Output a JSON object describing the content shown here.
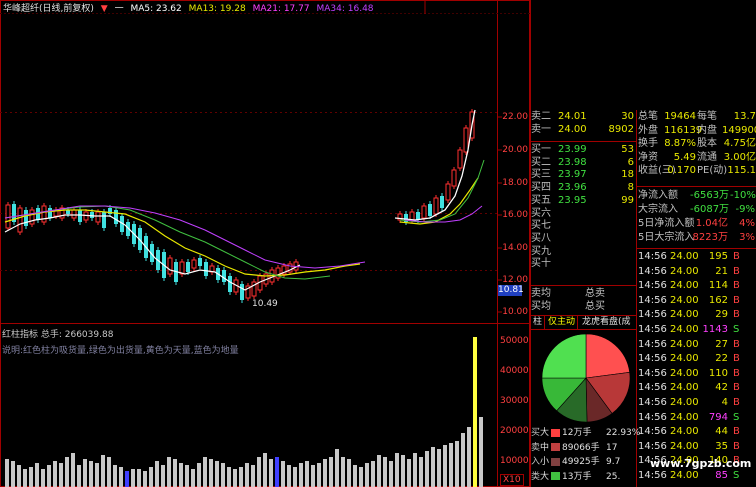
{
  "header": {
    "stock_name": "华峰超纤(日线,前复权)",
    "arrow": "一",
    "ma5": "MA5: 23.62",
    "ma13": "MA13: 19.28",
    "ma21": "MA21: 17.77",
    "ma34": "MA34: 16.48",
    "colors": {
      "ma5": "#ffffff",
      "ma13": "#e8e800",
      "ma21": "#ff40ff",
      "ma34": "#c040ff"
    }
  },
  "price_axis": [
    "22.00",
    "20.00",
    "18.00",
    "16.00",
    "14.00",
    "12.00",
    "10.00"
  ],
  "current_price_tag": "10.81",
  "low_marker": "10.49",
  "indicator": {
    "title": "红柱指标  总手: 266039.88",
    "description": "说明:红色柱为吸货量,绿色为出货量,黄色为天量,蓝色为地量",
    "volume_axis": [
      "50000",
      "40000",
      "30000",
      "20000",
      "10000"
    ],
    "unit": "X10"
  },
  "order_book": {
    "asks": [
      {
        "label": "卖二",
        "price": "24.01",
        "vol": "30"
      },
      {
        "label": "卖一",
        "price": "24.00",
        "vol": "8902"
      }
    ],
    "bids": [
      {
        "label": "买一",
        "price": "23.99",
        "vol": "53"
      },
      {
        "label": "买二",
        "price": "23.98",
        "vol": "6"
      },
      {
        "label": "买三",
        "price": "23.97",
        "vol": "18"
      },
      {
        "label": "买四",
        "price": "23.96",
        "vol": "8"
      },
      {
        "label": "买五",
        "price": "23.95",
        "vol": "99"
      },
      {
        "label": "买六",
        "price": "",
        "vol": ""
      },
      {
        "label": "买七",
        "price": "",
        "vol": ""
      },
      {
        "label": "买八",
        "price": "",
        "vol": ""
      },
      {
        "label": "买九",
        "price": "",
        "vol": ""
      },
      {
        "label": "买十",
        "price": "",
        "vol": ""
      }
    ],
    "avg_bid_label": "卖均",
    "avg_bid_total": "总卖",
    "avg_ask_label": "买均",
    "avg_ask_total": "总买"
  },
  "stats": [
    {
      "l1": "总笔",
      "v1": "19464",
      "l2": "每笔",
      "v2": "13.7"
    },
    {
      "l1": "外盘",
      "v1": "116139",
      "l2": "内盘",
      "v2": "149900"
    },
    {
      "l1": "换手",
      "v1": "8.87%",
      "l2": "股本",
      "v2": "4.75亿"
    },
    {
      "l1": "净资",
      "v1": "5.49",
      "l2": "流通",
      "v2": "3.00亿"
    },
    {
      "l1": "收益(三)",
      "v1": "0.170",
      "l2": "PE(动)",
      "v2": "115.1"
    }
  ],
  "flows": [
    {
      "label": "净流入额",
      "value": "-6563万",
      "pct": "-10%"
    },
    {
      "label": "大宗流入",
      "value": "-6087万",
      "pct": "-9%"
    },
    {
      "label": "5日净流入额",
      "value": "1.04亿",
      "pct": "4%"
    },
    {
      "label": "5日大宗流入",
      "value": "8223万",
      "pct": "3%"
    }
  ],
  "ticks": [
    {
      "time": "14:56",
      "price": "24.00",
      "vol": "195",
      "side": "B"
    },
    {
      "time": "14:56",
      "price": "24.00",
      "vol": "21",
      "side": "B"
    },
    {
      "time": "14:56",
      "price": "24.00",
      "vol": "114",
      "side": "B"
    },
    {
      "time": "14:56",
      "price": "24.00",
      "vol": "162",
      "side": "B"
    },
    {
      "time": "14:56",
      "price": "24.00",
      "vol": "29",
      "side": "B"
    },
    {
      "time": "14:56",
      "price": "24.00",
      "vol": "1143",
      "side": "S"
    },
    {
      "time": "14:56",
      "price": "24.00",
      "vol": "27",
      "side": "B"
    },
    {
      "time": "14:56",
      "price": "24.00",
      "vol": "22",
      "side": "B"
    },
    {
      "time": "14:56",
      "price": "24.00",
      "vol": "110",
      "side": "B"
    },
    {
      "time": "14:56",
      "price": "24.00",
      "vol": "42",
      "side": "B"
    },
    {
      "time": "14:56",
      "price": "24.00",
      "vol": "4",
      "side": "B"
    },
    {
      "time": "14:56",
      "price": "24.00",
      "vol": "794",
      "side": "S"
    },
    {
      "time": "14:56",
      "price": "24.00",
      "vol": "44",
      "side": "B"
    },
    {
      "time": "14:56",
      "price": "24.00",
      "vol": "35",
      "side": "B"
    },
    {
      "time": "14:56",
      "price": "24.00",
      "vol": "140",
      "side": "B"
    },
    {
      "time": "14:56",
      "price": "24.00",
      "vol": "85",
      "side": "S"
    }
  ],
  "tabs": {
    "t1": "柱",
    "t2": "仅主动",
    "t3": "龙虎看盘(成交量饼"
  },
  "pie_legend": [
    {
      "k": "大",
      "v": "12万手",
      "p": "22.93%",
      "color": "#ff4040"
    },
    {
      "k": "中",
      "v": "89066手",
      "p": "17",
      "color": "#c04040"
    },
    {
      "k": "小",
      "v": "49925手",
      "p": "9.7",
      "color": "#804040"
    },
    {
      "k": "大",
      "v": "13万手",
      "p": "25.",
      "color": "#40c040"
    }
  ],
  "side_labels": [
    "买",
    "卖",
    "入",
    "类"
  ],
  "pie": [
    {
      "name": "大买",
      "value": 22.93,
      "color": "#ff5050"
    },
    {
      "name": "中买",
      "value": 17,
      "color": "#b83838"
    },
    {
      "name": "小买",
      "value": 9.7,
      "color": "#6a2828"
    },
    {
      "name": "小卖",
      "value": 12,
      "color": "#286a28"
    },
    {
      "name": "中卖",
      "value": 13.37,
      "color": "#38b838"
    },
    {
      "name": "大卖",
      "value": 25,
      "color": "#50e050"
    }
  ],
  "watermark": "www.7gpzb.com"
}
